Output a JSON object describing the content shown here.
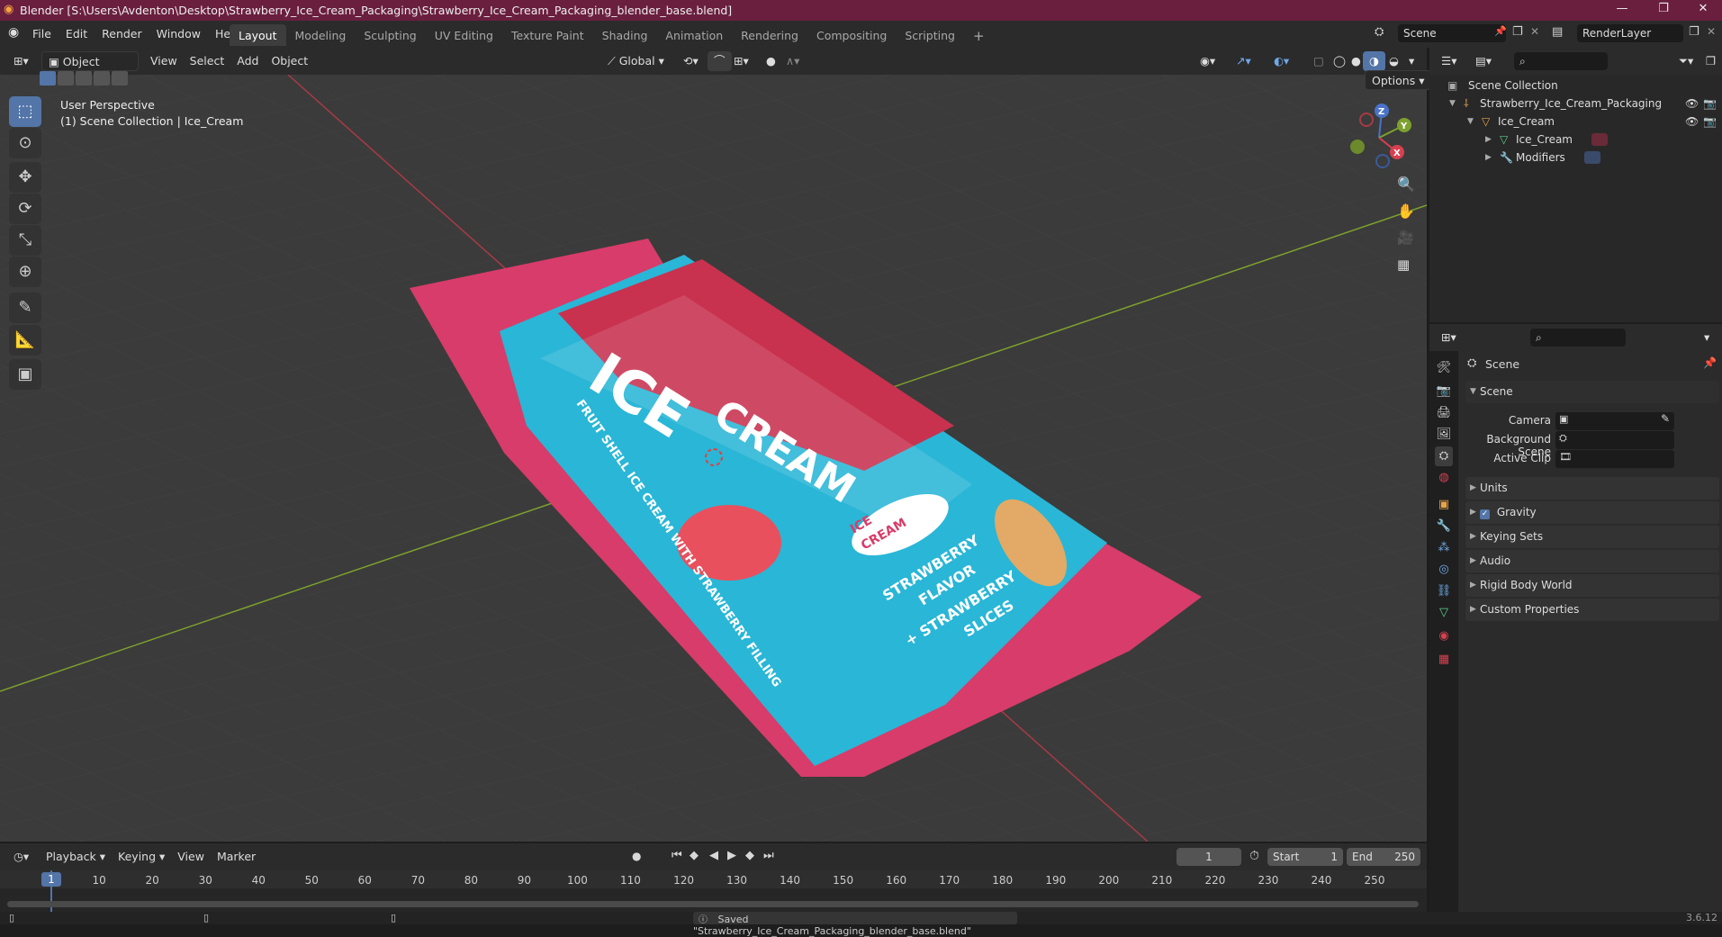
{
  "window": {
    "title": "Blender [S:\\Users\\Avdenton\\Desktop\\Strawberry_Ice_Cream_Packaging\\Strawberry_Ice_Cream_Packaging_blender_base.blend]"
  },
  "menu": [
    "File",
    "Edit",
    "Render",
    "Window",
    "Help"
  ],
  "workspaces": {
    "tabs": [
      "Layout",
      "Modeling",
      "Sculpting",
      "UV Editing",
      "Texture Paint",
      "Shading",
      "Animation",
      "Rendering",
      "Compositing",
      "Scripting"
    ],
    "active": "Layout",
    "add": "+"
  },
  "scene_selector": {
    "value": "Scene"
  },
  "renderlayer_selector": {
    "value": "RenderLayer"
  },
  "viewport_header": {
    "mode": "Object Mode",
    "menus": [
      "View",
      "Select",
      "Add",
      "Object"
    ],
    "transform": "Global",
    "options": "Options"
  },
  "viewport": {
    "perspective": "User Perspective",
    "collection": "(1) Scene Collection | Ice_Cream",
    "gizmo": {
      "x": "X",
      "y": "Y",
      "z": "Z"
    },
    "package_text": {
      "big1": "ICE",
      "big2": "CREAM",
      "badge1": "ICE",
      "badge2": "CREAM",
      "flavor1": "STRAWBERRY",
      "flavor2": "FLAVOR",
      "flavor3": "+ STRAWBERRY",
      "flavor4": "SLICES",
      "side": "FRUIT SHELL ICE CREAM WITH STRAWBERRY FILLING"
    }
  },
  "outliner": {
    "root": "Scene Collection",
    "items": [
      {
        "label": "Strawberry_Ice_Cream_Packaging",
        "level": 1
      },
      {
        "label": "Ice_Cream",
        "level": 2
      },
      {
        "label": "Ice_Cream",
        "level": 3
      },
      {
        "label": "Modifiers",
        "level": 3
      }
    ]
  },
  "properties": {
    "context": "Scene",
    "section": "Scene",
    "fields": [
      {
        "label": "Camera"
      },
      {
        "label": "Background Scene"
      },
      {
        "label": "Active Clip"
      }
    ],
    "panels": [
      "Units",
      "Gravity",
      "Keying Sets",
      "Audio",
      "Rigid Body World",
      "Custom Properties"
    ],
    "gravity_checked": true
  },
  "timeline": {
    "menus": [
      "Playback",
      "Keying",
      "View",
      "Marker"
    ],
    "current_frame": "1",
    "start_label": "Start",
    "start": "1",
    "end_label": "End",
    "end": "250",
    "ticks": [
      "1",
      "10",
      "20",
      "30",
      "40",
      "50",
      "60",
      "70",
      "80",
      "90",
      "100",
      "110",
      "120",
      "130",
      "140",
      "150",
      "160",
      "170",
      "180",
      "190",
      "200",
      "210",
      "220",
      "230",
      "240",
      "250"
    ]
  },
  "status": {
    "message": "Saved \"Strawberry_Ice_Cream_Packaging_blender_base.blend\"",
    "version": "3.6.12"
  },
  "colors": {
    "title_bar": "#6a1f3e",
    "accent": "#5375a8",
    "wrapper_pink": "#d83c6a",
    "wrapper_blue": "#2ab6d6",
    "x_axis": "#a83a45",
    "y_axis": "#7ea12e"
  }
}
